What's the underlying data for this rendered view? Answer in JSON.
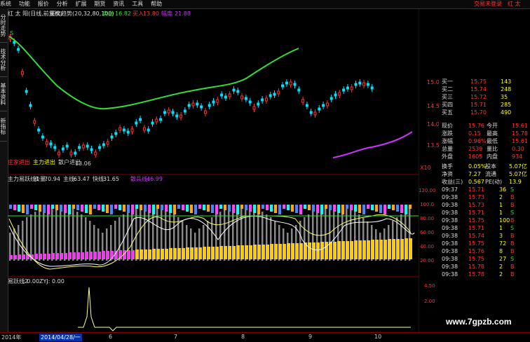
{
  "menu": {
    "items": [
      "系统",
      "功能",
      "报价",
      "分析",
      "扩展",
      "期货",
      "资讯",
      "工具",
      "帮助"
    ],
    "right_link": "交易未登录",
    "right_name": "红 太"
  },
  "sidetabs": [
    "分时走势",
    "技术分析",
    "基本资料",
    "新指标"
  ],
  "header": {
    "stock": "红 太 阳(日线,前复权)",
    "indicator": "买卖趋势(20,32,80,100)",
    "sell_label": "卖出",
    "sell_value": "16.82",
    "buy_label": "买入",
    "buy_value": "13.80",
    "amp_label": "幅度",
    "amp_value": "21.88"
  },
  "main_chart": {
    "high_label": "16.82",
    "low_label": "13.06",
    "signal_s": "S",
    "signal_b": "B",
    "legend_a": "庄家进出",
    "legend_b": "主力进出",
    "legend_c": "散户进出",
    "y_ticks": [
      "15.00",
      "14.50",
      "14.00",
      "13.50"
    ],
    "x10_label": "X10"
  },
  "indicator1": {
    "title": "主力易跃线1",
    "price_label": "价量:",
    "price_value": "70.94",
    "main_label": "主线:",
    "main_value": "63.47",
    "fast_label": "快线:",
    "fast_value": "31.65",
    "retail_label": "散兵线:",
    "retail_value": "46.99",
    "y_ticks": [
      "120.00",
      "100.0",
      "80.00",
      "60.00",
      "40.00",
      "20.00"
    ]
  },
  "indicator2": {
    "title": "易跃线2",
    "value_label": ": 0.00",
    "zyj_label": "ZYJ: 0.00",
    "y_ticks": [
      "4.50",
      "2.00"
    ]
  },
  "quotes": {
    "asks": [
      {
        "label": "卖五",
        "price": "",
        "vol": ""
      },
      {
        "label": "买一",
        "price": "15.75",
        "vol": "143"
      },
      {
        "label": "买二",
        "price": "15.74",
        "vol": "248"
      },
      {
        "label": "买三",
        "price": "15.72",
        "vol": "35"
      },
      {
        "label": "买四",
        "price": "15.71",
        "vol": "285"
      },
      {
        "label": "买五",
        "price": "15.70",
        "vol": "490"
      }
    ],
    "stats": [
      {
        "l1": "现价",
        "v1": "15.76",
        "l2": "今开",
        "v2": "15.61"
      },
      {
        "l1": "涨跌",
        "v1": "0.15",
        "l2": "最高",
        "v2": "15.78"
      },
      {
        "l1": "涨幅",
        "v1": "0.96%",
        "l2": "最低",
        "v2": "15.61"
      },
      {
        "l1": "总量",
        "v1": "2539",
        "l2": "量比",
        "v2": "0.30"
      },
      {
        "l1": "外盘",
        "v1": "1605",
        "l2": "内盘",
        "v2": "934"
      }
    ],
    "stats2": [
      {
        "l1": "换手",
        "v1": "0.05%",
        "l2": "股本",
        "v2": "5.07亿"
      },
      {
        "l1": "净资",
        "v1": "7.27",
        "l2": "流通",
        "v2": "5.07亿"
      },
      {
        "l1": "收益(三)",
        "v1": "0.567",
        "l2": "PE(动)",
        "v2": "13.9"
      }
    ],
    "ticks": [
      {
        "t": "09:37",
        "p": "15.71",
        "v": "36",
        "f": "S"
      },
      {
        "t": "09:38",
        "p": "15.73",
        "v": "2",
        "f": "B"
      },
      {
        "t": "09:38",
        "p": "15.73",
        "v": "1",
        "f": "B"
      },
      {
        "t": "09:38",
        "p": "15.71",
        "v": "1",
        "f": "S"
      },
      {
        "t": "09:38",
        "p": "15.75",
        "v": "100",
        "f": "B"
      },
      {
        "t": "09:38",
        "p": "15.71",
        "v": "1",
        "f": "S"
      },
      {
        "t": "09:38",
        "p": "15.74",
        "v": "3",
        "f": "B"
      },
      {
        "t": "09:38",
        "p": "15.75",
        "v": "72",
        "f": "B"
      },
      {
        "t": "09:38",
        "p": "15.76",
        "v": "8",
        "f": "B"
      },
      {
        "t": "09:38",
        "p": "15.75",
        "v": "27",
        "f": "S"
      },
      {
        "t": "09:38",
        "p": "15.78",
        "v": "2",
        "f": "B"
      },
      {
        "t": "09:38",
        "p": "15.78",
        "v": "2",
        "f": "B"
      }
    ]
  },
  "dates": [
    "2014年",
    "2014/04/28/一",
    "6",
    "7",
    "8",
    "9",
    "10"
  ],
  "watermark": "www.7gpzb.com",
  "colors": {
    "up": "#ff3030",
    "down": "#00e0ff",
    "ma": "#33dd33",
    "purple": "#cc33ff",
    "yellow": "#ffff00"
  }
}
